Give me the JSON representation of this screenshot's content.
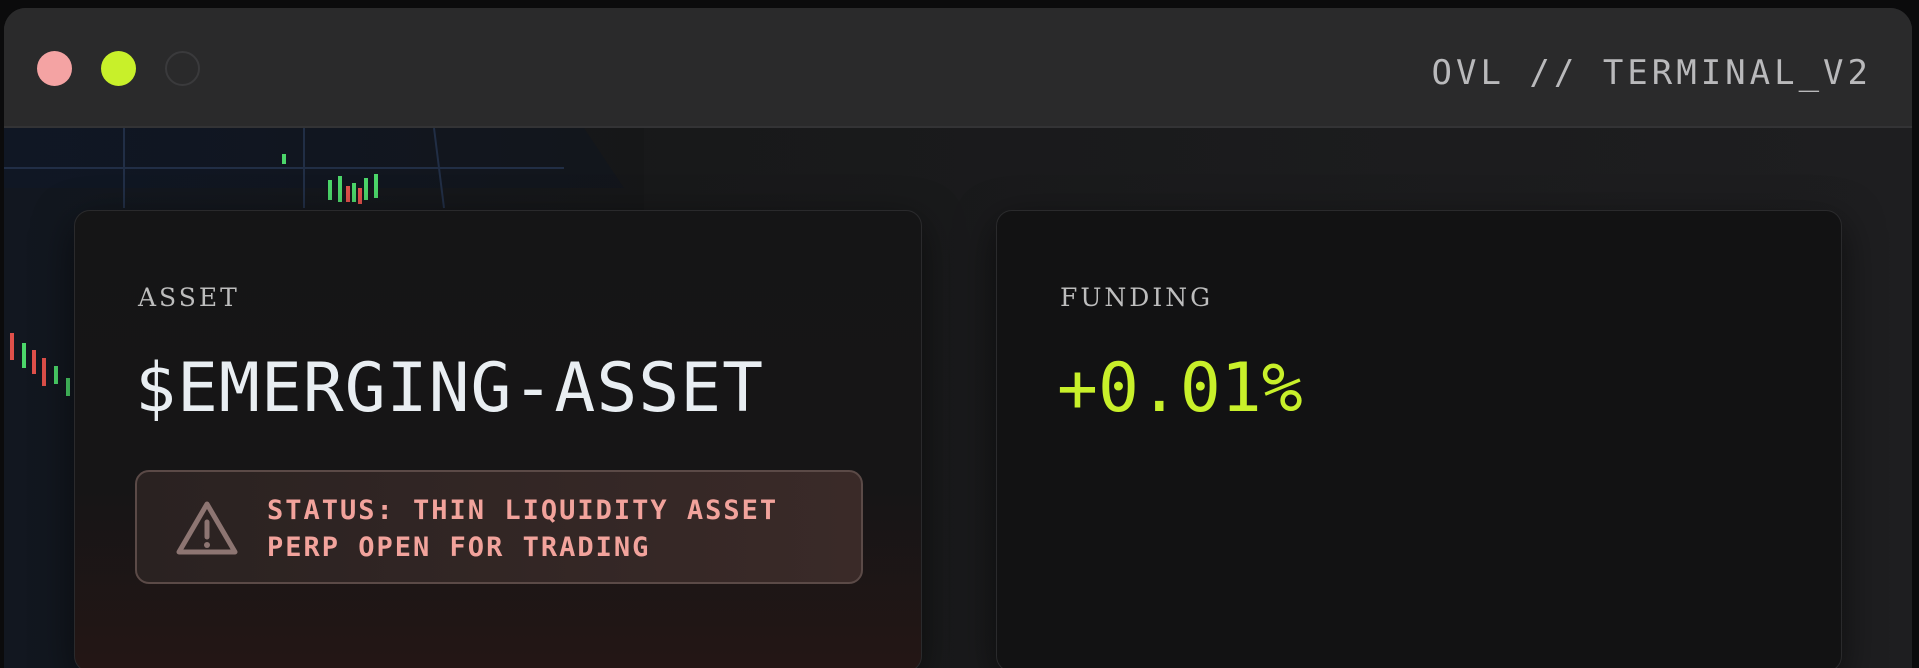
{
  "window": {
    "title": "OVL // TERMINAL_V2",
    "controls": [
      "close",
      "maximize",
      "minimize"
    ]
  },
  "cards": {
    "asset": {
      "label": "ASSET",
      "name": "$EMERGING-ASSET",
      "status": {
        "icon": "warning-triangle-icon",
        "line1": "STATUS: THIN LIQUIDITY ASSET",
        "line2": "PERP OPEN FOR TRADING"
      }
    },
    "funding": {
      "label": "FUNDING",
      "value": "+0.01%"
    }
  },
  "colors": {
    "accent_green": "#c8f02a",
    "close_dot": "#f4a3a3",
    "warning_text": "#f2a39c"
  }
}
